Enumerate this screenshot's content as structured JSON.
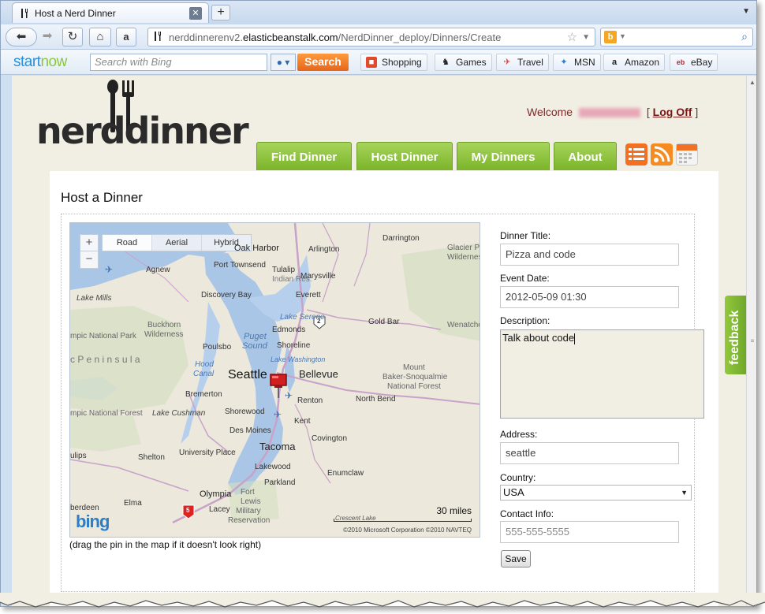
{
  "browser": {
    "tab_title": "Host a Nerd Dinner",
    "new_tab_label": "+",
    "url_prefix": "nerddinnerenv2.",
    "url_domain": "elasticbeanstalk.com",
    "url_path": "/NerdDinner_deploy/Dinners/Create",
    "search_engine_icon": "bing-icon"
  },
  "toolbar": {
    "brand_start": "start",
    "brand_now": "now",
    "search_placeholder": "Search with Bing",
    "search_button": "Search",
    "bookmarks": [
      {
        "label": "Shopping",
        "icon": "shopping-icon"
      },
      {
        "label": "Games",
        "icon": "games-icon"
      },
      {
        "label": "Travel",
        "icon": "travel-icon"
      },
      {
        "label": "MSN",
        "icon": "msn-icon"
      },
      {
        "label": "Amazon",
        "icon": "amazon-icon"
      },
      {
        "label": "eBay",
        "icon": "ebay-icon"
      }
    ]
  },
  "site": {
    "logo_text": "nerddinner",
    "welcome_prefix": "Welcome",
    "bracket_open": "[",
    "logoff_label": "Log Off",
    "bracket_close": "]",
    "nav": [
      "Find Dinner",
      "Host Dinner",
      "My Dinners",
      "About"
    ],
    "feedback_label": "feedback",
    "accent_green": "#7bb42a"
  },
  "page": {
    "heading": "Host a Dinner",
    "map_caption": "(drag the pin in the map if it doesn't look right)"
  },
  "map": {
    "view_modes": [
      "Road",
      "Aerial",
      "Hybrid"
    ],
    "selected_mode": "Road",
    "zoom_in": "+",
    "zoom_out": "−",
    "scale_label": "30 miles",
    "copyright": "©2010 Microsoft Corporation   ©2010 NAVTEQ",
    "logo": "bing",
    "labels": {
      "oak_harbor": "Oak Harbor",
      "darrington": "Darrington",
      "arlington": "Arlington",
      "glacier_peak": "Glacier Pe",
      "wilderness": "Wilderness",
      "port_townsend": "Port Townsend",
      "agnew": "Agnew",
      "tulalip": "Tulalip",
      "indian_res": "Indian Res.",
      "marysville": "Marysville",
      "lake_mills": "Lake Mills",
      "discovery_bay": "Discovery Bay",
      "everett": "Everett",
      "lake_serene": "Lake Serene",
      "gold_bar": "Gold Bar",
      "wenatchee": "Wenatche",
      "buckhorn": "Buckhorn",
      "buckhorn2": "Wilderness",
      "edmonds": "Edmonds",
      "olympic_np": "mpic National Park",
      "poulsbo": "Poulsbo",
      "puget": "Puget",
      "sound": "Sound",
      "shoreline": "Shoreline",
      "peninsula": "c   P e n i n s u l a",
      "hood": "Hood",
      "canal": "Canal",
      "lake_wash": "Lake Washington",
      "mount": "Mount",
      "baker": "Baker-Snoqualmie",
      "nf": "National Forest",
      "seattle": "Seattle",
      "bellevue": "Bellevue",
      "bremerton": "Bremerton",
      "renton": "Renton",
      "north_bend": "North Bend",
      "olympic_nf": "mpic National Forest",
      "lake_cushman": "Lake Cushman",
      "shorewood": "Shorewood",
      "des_moines": "Des Moines",
      "kent": "Kent",
      "covington": "Covington",
      "university_place": "University Place",
      "tacoma": "Tacoma",
      "shelton": "Shelton",
      "ulips": "ulips",
      "lakewood": "Lakewood",
      "enumclaw": "Enumclaw",
      "parkland": "Parkland",
      "olympia": "Olympia",
      "fort_lewis": "Fort",
      "fort_lewis2": "Lewis",
      "military": "Military",
      "reservation": "Reservation",
      "aberdeen": "berdeen",
      "elma": "Elma",
      "lacey": "Lacey",
      "crescent": "Crescent Lake",
      "hwy2": "2",
      "hwy5": "5"
    }
  },
  "form": {
    "dinner_title_label": "Dinner Title:",
    "dinner_title_value": "Pizza and code",
    "event_date_label": "Event Date:",
    "event_date_value": "2012-05-09 01:30",
    "description_label": "Description:",
    "description_value": "Talk about code",
    "address_label": "Address:",
    "address_value": "seattle",
    "country_label": "Country:",
    "country_value": "USA",
    "contact_label": "Contact Info:",
    "contact_placeholder": "555-555-5555",
    "save_label": "Save"
  }
}
